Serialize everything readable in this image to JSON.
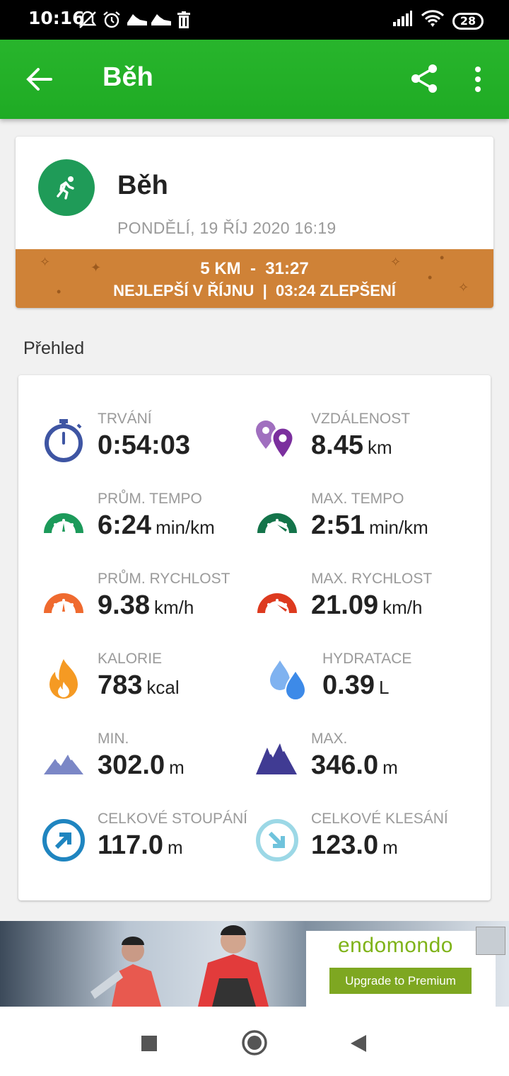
{
  "status_bar": {
    "time": "10:16",
    "battery": "28",
    "icons": [
      "mute-icon",
      "alarm-icon",
      "shoe-icon",
      "shoe-icon",
      "trash-icon",
      "signal-icon",
      "wifi-icon",
      "battery-icon"
    ]
  },
  "app_bar": {
    "title": "Běh",
    "accent": "#22b127"
  },
  "workout": {
    "title": "Běh",
    "date": "PONDĚLÍ, 19 ŘÍJ 2020 16:19",
    "banner_line1": "5 KM  -  31:27",
    "banner_line2": "NEJLEPŠÍ V ŘÍJNU  |  03:24 ZLEPŠENÍ",
    "banner_color": "#cf8237",
    "icon": "running-icon"
  },
  "overview": {
    "title": "Přehled",
    "stats": [
      {
        "label": "TRVÁNÍ",
        "value": "0:54:03",
        "unit": "",
        "icon": "stopwatch-icon"
      },
      {
        "label": "VZDÁLENOST",
        "value": "8.45",
        "unit": "km",
        "icon": "location-pin-icon"
      },
      {
        "label": "PRŮM. TEMPO",
        "value": "6:24",
        "unit": "min/km",
        "icon": "gauge-icon"
      },
      {
        "label": "MAX. TEMPO",
        "value": "2:51",
        "unit": "min/km",
        "icon": "gauge-icon"
      },
      {
        "label": "PRŮM. RYCHLOST",
        "value": "9.38",
        "unit": "km/h",
        "icon": "speedometer-icon"
      },
      {
        "label": "MAX. RYCHLOST",
        "value": "21.09",
        "unit": "km/h",
        "icon": "speedometer-icon"
      },
      {
        "label": "KALORIE",
        "value": "783",
        "unit": "kcal",
        "icon": "flame-icon"
      },
      {
        "label": "HYDRATACE",
        "value": "0.39",
        "unit": "L",
        "icon": "water-drops-icon"
      },
      {
        "label": "MIN.",
        "value": "302.0",
        "unit": "m",
        "icon": "mountain-icon"
      },
      {
        "label": "MAX.",
        "value": "346.0",
        "unit": "m",
        "icon": "mountain-icon"
      },
      {
        "label": "CELKOVÉ STOUPÁNÍ",
        "value": "117.0",
        "unit": "m",
        "icon": "ascent-arrow-icon"
      },
      {
        "label": "CELKOVÉ KLESÁNÍ",
        "value": "123.0",
        "unit": "m",
        "icon": "descent-arrow-icon"
      }
    ]
  },
  "ad": {
    "brand": "endomondo",
    "button": "Upgrade to Premium"
  },
  "nav": {
    "icons": [
      "recent-apps-icon",
      "home-icon",
      "back-icon"
    ]
  }
}
